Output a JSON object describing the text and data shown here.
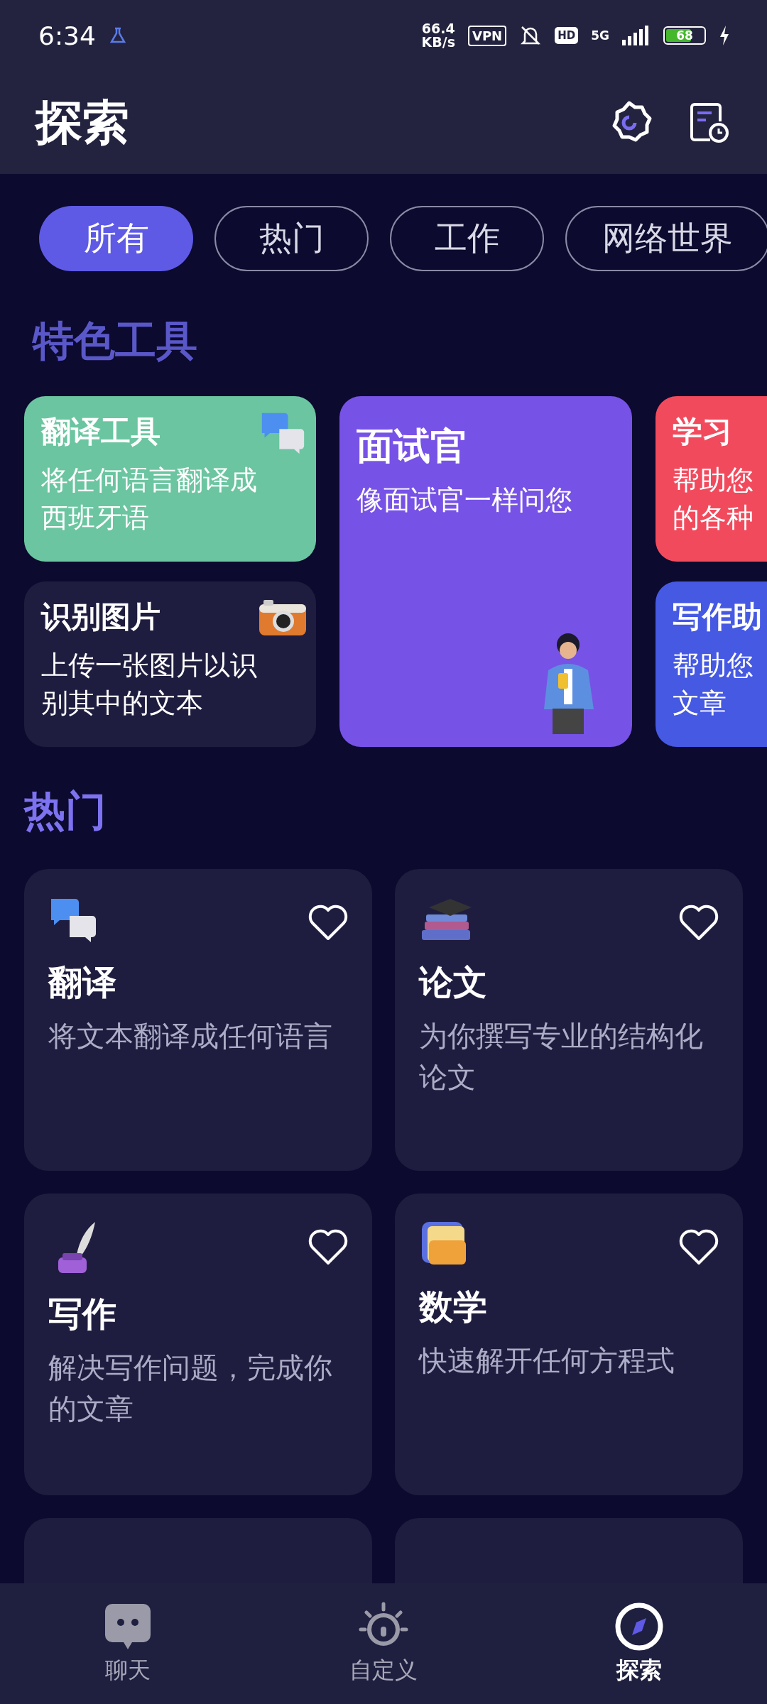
{
  "status_bar": {
    "time": "6:34",
    "speed": "66.4",
    "speed_unit": "KB/s",
    "vpn": "VPN",
    "hd": "HD",
    "network": "5G",
    "battery": "68"
  },
  "header": {
    "title": "探索"
  },
  "chips": [
    {
      "label": "所有",
      "selected": true
    },
    {
      "label": "热门",
      "selected": false
    },
    {
      "label": "工作",
      "selected": false
    },
    {
      "label": "网络世界",
      "selected": false
    }
  ],
  "featured": {
    "title": "特色工具",
    "cards": [
      {
        "kind": "translate",
        "title": "翻译工具",
        "description": "将任何语言翻译成西班牙语",
        "color": "#6bc5a0"
      },
      {
        "kind": "camera",
        "title": "识别图片",
        "description": "上传一张图片以识别其中的文本",
        "color": "#1f1d3f"
      },
      {
        "kind": "person",
        "title": "面试官",
        "description": "像面试官一样问您",
        "color": "#7752e6"
      },
      {
        "kind": "cut",
        "title": "学习",
        "description_lines": [
          "帮助您",
          "的各种"
        ],
        "color": "#f24a5d"
      },
      {
        "kind": "cut",
        "title": "写作助",
        "description_lines": [
          "帮助您",
          "文章"
        ],
        "color": "#4659e3"
      }
    ]
  },
  "popular": {
    "title": "热门",
    "cards": [
      {
        "kind": "translate",
        "title": "翻译",
        "description": "将文本翻译成任何语言",
        "favorite": false
      },
      {
        "kind": "books",
        "title": "论文",
        "description": "为你撰写专业的结构化论文",
        "favorite": false
      },
      {
        "kind": "quill",
        "title": "写作",
        "description": "解决写作问题，完成你的文章",
        "favorite": false
      },
      {
        "kind": "notepad",
        "title": "数学",
        "description": "快速解开任何方程式",
        "favorite": false
      },
      {
        "kind": "partial"
      },
      {
        "kind": "partial"
      }
    ]
  },
  "nav": [
    {
      "kind": "chat",
      "label": "聊天",
      "selected": false
    },
    {
      "kind": "bulb",
      "label": "自定义",
      "selected": false
    },
    {
      "kind": "compass",
      "label": "探索",
      "selected": true
    }
  ]
}
